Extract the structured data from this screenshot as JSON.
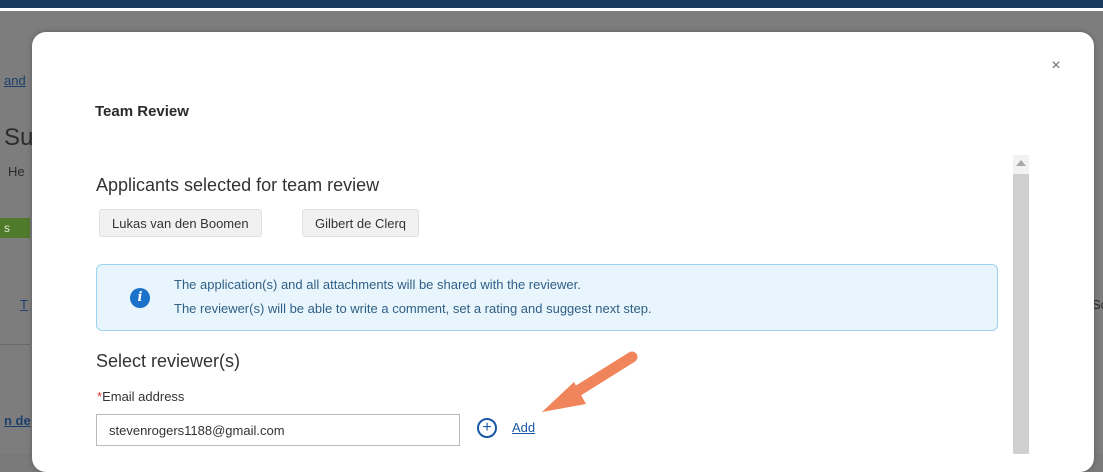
{
  "background": {
    "breadcrumb_fragment": "and",
    "title_fragment": "Su",
    "subtitle_fragment": "He",
    "green_tab_fragment": "s",
    "link_fragment": "T",
    "right_fragment": "Sc",
    "bottom_link_fragment": "n de"
  },
  "modal": {
    "title": "Team Review",
    "close_glyph": "×",
    "applicants_heading": "Applicants selected for team review",
    "applicants": [
      "Lukas van den Boomen",
      "Gilbert de Clerq"
    ],
    "info": {
      "line1": "The application(s) and all attachments will be shared with the reviewer.",
      "line2": "The reviewer(s) will be able to write a comment, set a rating and suggest next step."
    },
    "reviewer_heading": "Select reviewer(s)",
    "email": {
      "required_mark": "*",
      "label": "Email address",
      "value": "stevenrogers1188@gmail.com"
    },
    "add": {
      "icon": "plus-circle-icon",
      "label": "Add"
    }
  },
  "colors": {
    "header_bg": "#17395c",
    "accent_blue": "#1a57a6",
    "info_bg": "#e9f5fc",
    "info_border": "#9cd3ee",
    "arrow": "#f0845a",
    "required": "#d9342b"
  }
}
